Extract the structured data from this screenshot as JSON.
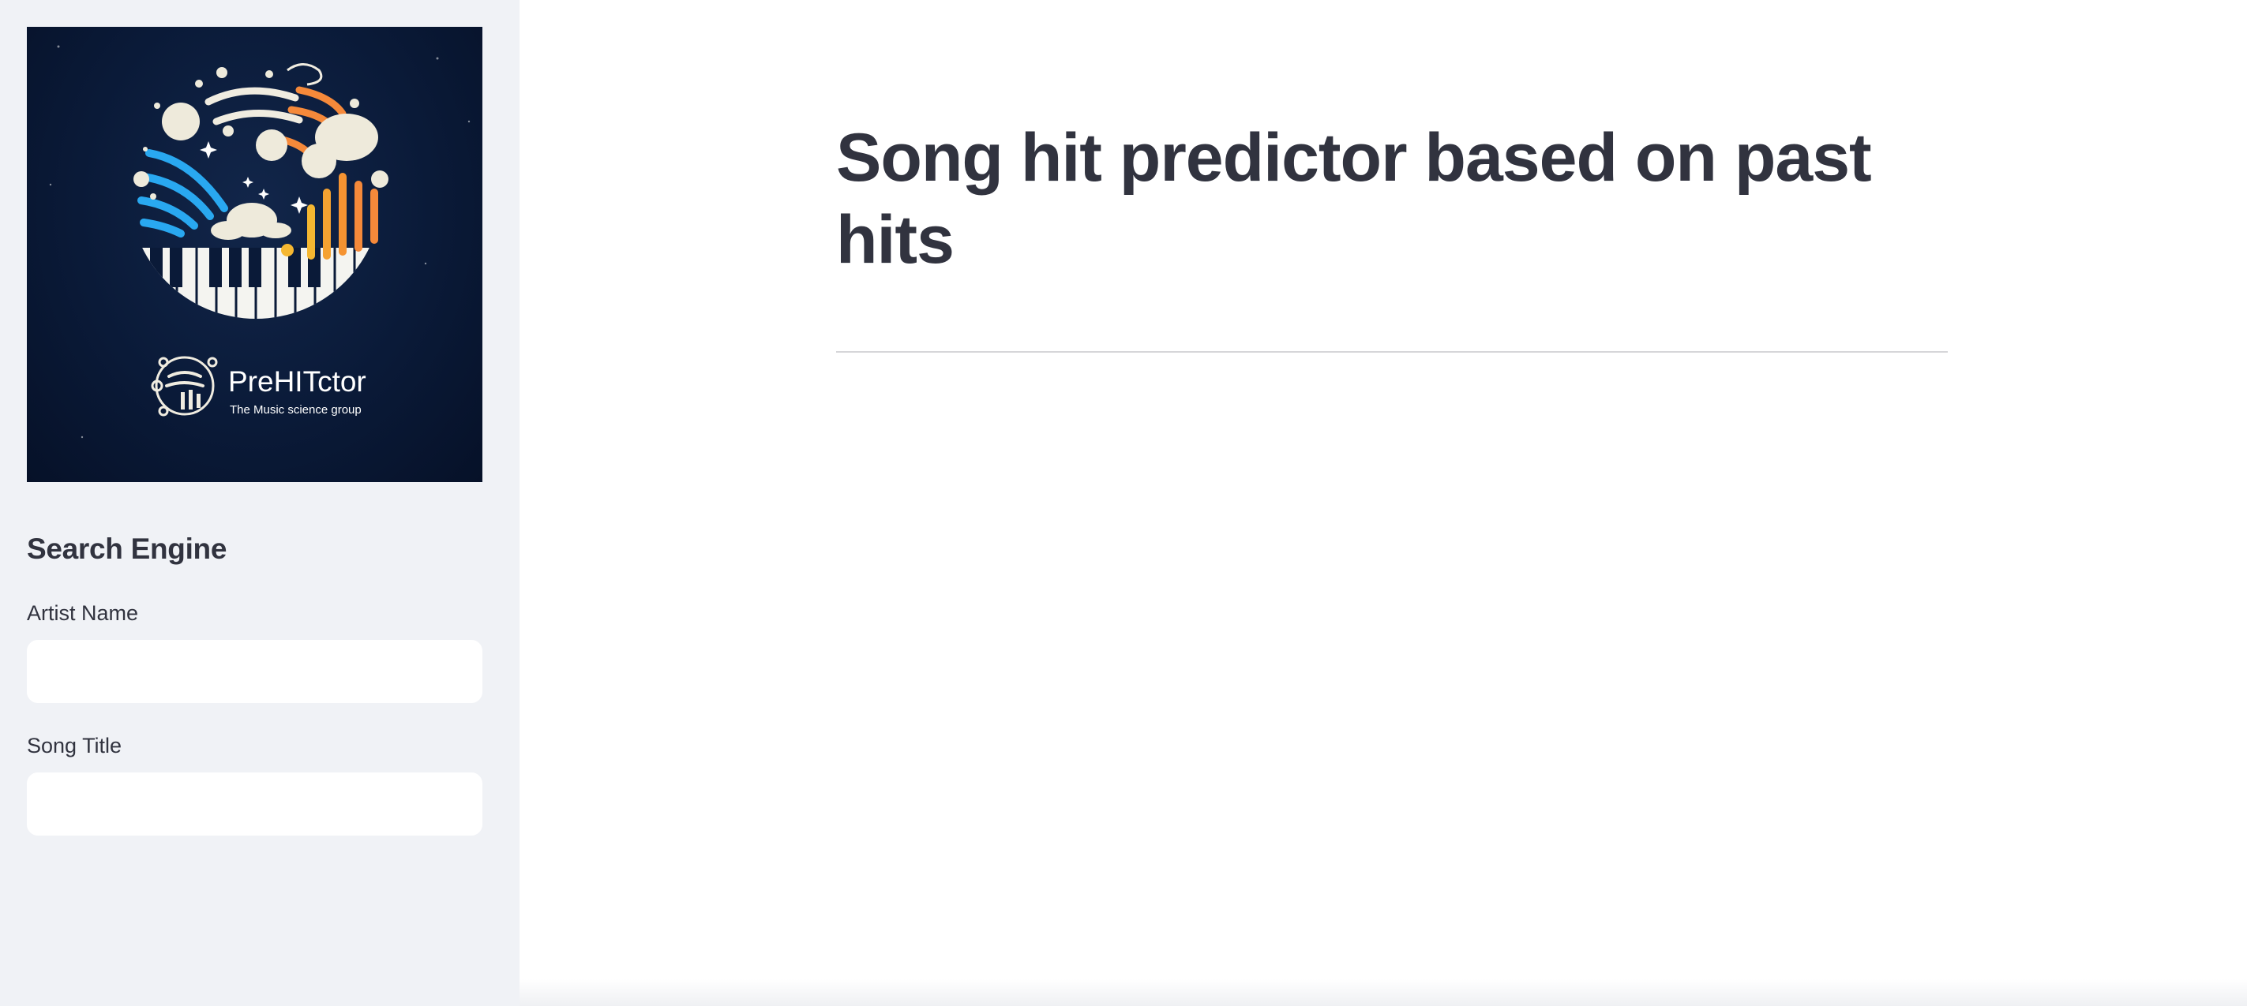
{
  "sidebar": {
    "logo": {
      "brand_name": "PreHITctor",
      "tagline": "The Music science group",
      "icon": "music-planet-logo-icon"
    },
    "heading": "Search Engine",
    "fields": [
      {
        "label": "Artist Name",
        "value": "",
        "placeholder": ""
      },
      {
        "label": "Song Title",
        "value": "",
        "placeholder": ""
      }
    ]
  },
  "main": {
    "title": "Song hit predictor based on past hits"
  },
  "colors": {
    "sidebar_bg": "#f0f2f6",
    "text": "#31333f",
    "logo_bg": "#0a1a38",
    "blue_accent": "#29a8f0",
    "orange_accent": "#f5893a",
    "yellow_accent": "#f5b731"
  }
}
